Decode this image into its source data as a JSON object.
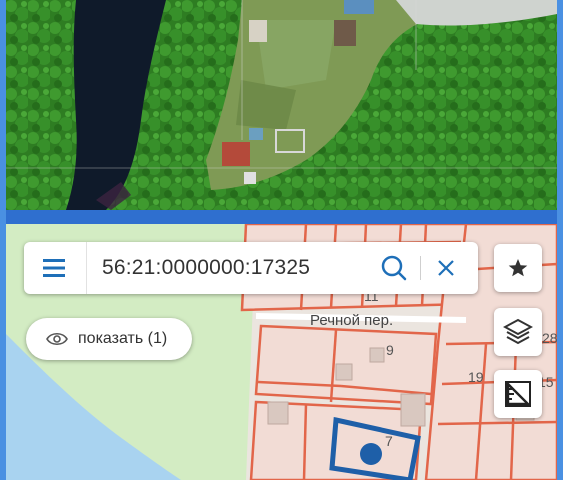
{
  "search": {
    "value": "56:21:0000000:17325",
    "menu_icon": "menu-icon",
    "search_icon": "search-icon",
    "clear_icon": "close-icon"
  },
  "show_button": {
    "label": "показать (1)",
    "icon": "eye-icon"
  },
  "map_controls": {
    "favorite_icon": "star-icon",
    "layers_icon": "layers-icon",
    "ruler_icon": "ruler-icon"
  },
  "map": {
    "street_label": "Речной пер.",
    "parcel_labels": [
      "11",
      "9",
      "7",
      "19",
      "28",
      "15"
    ],
    "colors": {
      "parcel_border": "#e2664a",
      "selected_border": "#1e5fa8",
      "water": "#a9d3f0",
      "green": "#d3ecc3",
      "accent": "#4a90e2"
    }
  }
}
